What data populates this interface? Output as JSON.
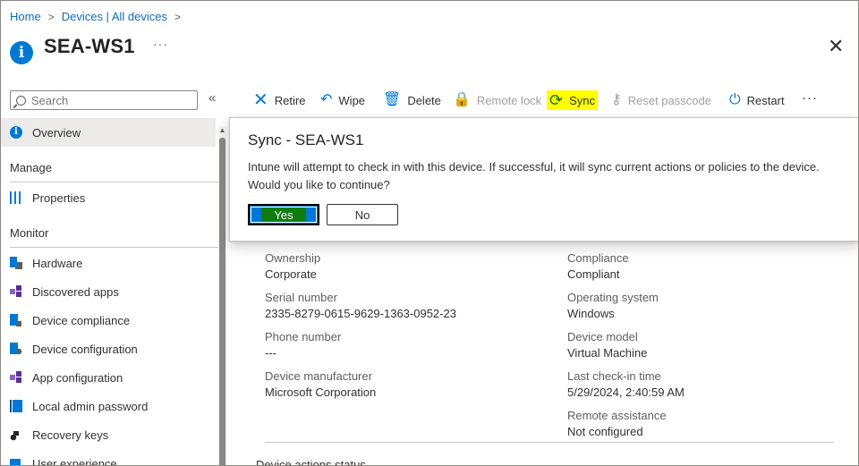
{
  "breadcrumb": {
    "items": [
      "Home",
      "Devices | All devices"
    ]
  },
  "header": {
    "title": "SEA-WS1",
    "more": "···",
    "close": "✕"
  },
  "search": {
    "placeholder": "Search",
    "collapse": "«"
  },
  "sidebar": {
    "overview": "Overview",
    "manage_heading": "Manage",
    "properties": "Properties",
    "monitor_heading": "Monitor",
    "items": [
      {
        "label": "Hardware",
        "icon": "hardware-icon"
      },
      {
        "label": "Discovered apps",
        "icon": "apps-icon"
      },
      {
        "label": "Device compliance",
        "icon": "compliance-icon"
      },
      {
        "label": "Device configuration",
        "icon": "configuration-icon"
      },
      {
        "label": "App configuration",
        "icon": "apps-icon"
      },
      {
        "label": "Local admin password",
        "icon": "password-icon"
      },
      {
        "label": "Recovery keys",
        "icon": "key-icon"
      },
      {
        "label": "User experience",
        "icon": "user-experience-icon"
      }
    ]
  },
  "toolbar": {
    "retire": "Retire",
    "wipe": "Wipe",
    "delete": "Delete",
    "remote_lock": "Remote lock",
    "sync": "Sync",
    "reset_passcode": "Reset passcode",
    "restart": "Restart",
    "more": "···"
  },
  "details": {
    "ownership_label": "Ownership",
    "ownership_value": "Corporate",
    "serial_label": "Serial number",
    "serial_value": "2335-8279-0615-9629-1363-0952-23",
    "phone_label": "Phone number",
    "phone_value": "---",
    "manufacturer_label": "Device manufacturer",
    "manufacturer_value": "Microsoft Corporation",
    "compliance_label": "Compliance",
    "compliance_value": "Compliant",
    "os_label": "Operating system",
    "os_value": "Windows",
    "model_label": "Device model",
    "model_value": "Virtual Machine",
    "checkin_label": "Last check-in time",
    "checkin_value": "5/29/2024, 2:40:59 AM",
    "remote_label": "Remote assistance",
    "remote_value": "Not configured",
    "actions_status": "Device actions status"
  },
  "dialog": {
    "title": "Sync - SEA-WS1",
    "message": "Intune will attempt to check in with this device. If successful, it will sync current actions or policies to the device. Would you like to continue?",
    "yes": "Yes",
    "no": "No"
  },
  "colors": {
    "accent": "#0078d4",
    "sync_highlight": "#ffff00",
    "yes_highlight": "#107c10"
  }
}
